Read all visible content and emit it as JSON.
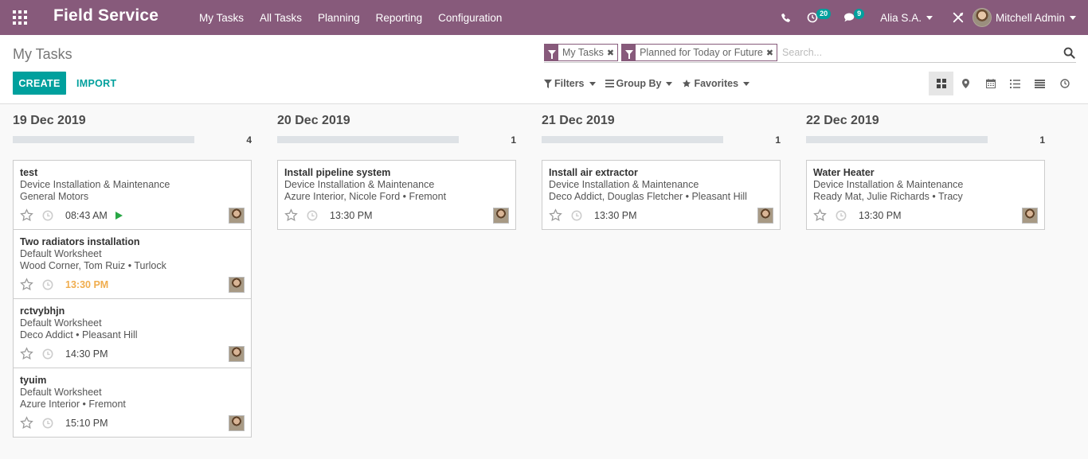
{
  "navbar": {
    "brand": "Field Service",
    "menu": [
      "My Tasks",
      "All Tasks",
      "Planning",
      "Reporting",
      "Configuration"
    ],
    "activity_count": "20",
    "message_count": "9",
    "company": "Alia S.A.",
    "user": "Mitchell Admin"
  },
  "control": {
    "breadcrumb": "My Tasks",
    "create_label": "CREATE",
    "import_label": "IMPORT",
    "facets": [
      "My Tasks",
      "Planned for Today or Future"
    ],
    "search_placeholder": "Search...",
    "filters_label": "Filters",
    "groupby_label": "Group By",
    "favorites_label": "Favorites"
  },
  "colors": {
    "primary": "#875A7B",
    "accent": "#00A09D",
    "late": "#f0ad4e",
    "running": "#28a745"
  },
  "columns": [
    {
      "title": "19 Dec 2019",
      "count": "4",
      "cards": [
        {
          "title": "test",
          "line1": "Device Installation & Maintenance",
          "line2": "General Motors",
          "time": "08:43 AM",
          "running": true,
          "late": false
        },
        {
          "title": "Two radiators installation",
          "line1": "Default Worksheet",
          "line2": "Wood Corner, Tom Ruiz • Turlock",
          "time": "13:30 PM",
          "running": false,
          "late": true
        },
        {
          "title": "rctvybhjn",
          "line1": "Default Worksheet",
          "line2": "Deco Addict • Pleasant Hill",
          "time": "14:30 PM",
          "running": false,
          "late": false
        },
        {
          "title": "tyuim",
          "line1": "Default Worksheet",
          "line2": "Azure Interior • Fremont",
          "time": "15:10 PM",
          "running": false,
          "late": false
        }
      ]
    },
    {
      "title": "20 Dec 2019",
      "count": "1",
      "cards": [
        {
          "title": "Install pipeline system",
          "line1": "Device Installation & Maintenance",
          "line2": "Azure Interior, Nicole Ford • Fremont",
          "time": "13:30 PM",
          "running": false,
          "late": false
        }
      ]
    },
    {
      "title": "21 Dec 2019",
      "count": "1",
      "cards": [
        {
          "title": "Install air extractor",
          "line1": "Device Installation & Maintenance",
          "line2": "Deco Addict, Douglas Fletcher • Pleasant Hill",
          "time": "13:30 PM",
          "running": false,
          "late": false
        }
      ]
    },
    {
      "title": "22 Dec 2019",
      "count": "1",
      "cards": [
        {
          "title": "Water Heater",
          "line1": "Device Installation & Maintenance",
          "line2": "Ready Mat, Julie Richards • Tracy",
          "time": "13:30 PM",
          "running": false,
          "late": false
        }
      ]
    }
  ]
}
